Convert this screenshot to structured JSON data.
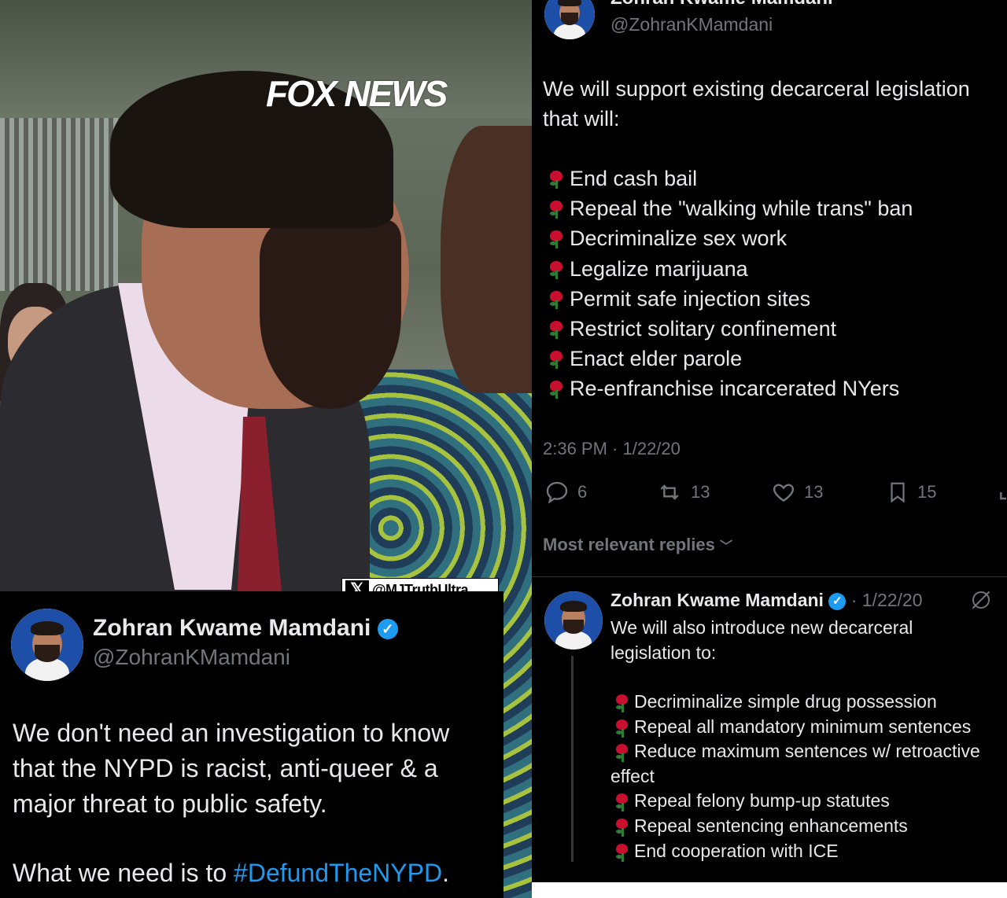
{
  "video": {
    "channel_logo": "FOX NEWS",
    "watermark": {
      "icon": "x-logo-icon",
      "handle": "@MJTruthUltra"
    }
  },
  "left_tweet": {
    "display_name": "Zohran Kwame Mamdani",
    "handle": "@ZohranKMamdani",
    "text_line1": "We don't need an investigation to know",
    "text_line2": "that the NYPD is racist, anti-queer & a",
    "text_line3": "major threat to public safety.",
    "text_line4_prefix": "What we need is to ",
    "hashtag": "#DefundTheNYPD",
    "text_line4_suffix": "."
  },
  "right_tweet": {
    "display_name_partial": "Zohran Kwame Mamdani",
    "handle": "@ZohranKMamdani",
    "intro_line1": "We will support existing decarceral legislation",
    "intro_line2": "that will:",
    "items": [
      "End cash bail",
      "Repeal the \"walking while trans\" ban",
      "Decriminalize sex work",
      "Legalize marijuana",
      "Permit safe injection sites",
      "Restrict solitary confinement",
      "Enact elder parole",
      "Re-enfranchise incarcerated NYers"
    ],
    "timestamp": "2:36 PM · 1/22/20",
    "stats": {
      "replies": "6",
      "reposts": "13",
      "likes": "13",
      "bookmarks": "15"
    },
    "replies_sort": "Most relevant replies"
  },
  "reply": {
    "display_name": "Zohran Kwame Mamdani",
    "date": "· 1/22/20",
    "intro_line1": "We will also introduce new decarceral",
    "intro_line2": "legislation to:",
    "items": [
      "Decriminalize simple drug possession",
      "Repeal all mandatory minimum sentences",
      "Reduce maximum sentences w/ retroactive"
    ],
    "items_continued": "effect",
    "items2": [
      "Repeal felony bump-up statutes",
      "Repeal sentencing enhancements",
      "End cooperation with ICE"
    ]
  },
  "colors": {
    "verified": "#1d9bf0",
    "link": "#1d9bf0",
    "muted": "#71767b",
    "rose": "#c8102e"
  }
}
